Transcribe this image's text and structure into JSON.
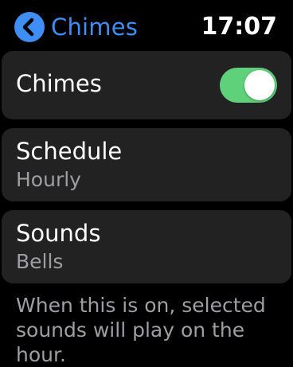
{
  "header": {
    "back_label": "Chimes",
    "time": "17:07"
  },
  "cells": {
    "chimes": {
      "title": "Chimes",
      "toggle_on": true
    },
    "schedule": {
      "title": "Schedule",
      "value": "Hourly"
    },
    "sounds": {
      "title": "Sounds",
      "value": "Bells"
    }
  },
  "footer": {
    "description": "When this is on, selected sounds will play on the hour."
  },
  "colors": {
    "accent": "#3f8ef5",
    "toggle_on": "#5fd17a",
    "cell_background": "#222222",
    "secondary_text": "#9e9ea3"
  },
  "icons": {
    "back": "chevron-left-icon"
  }
}
